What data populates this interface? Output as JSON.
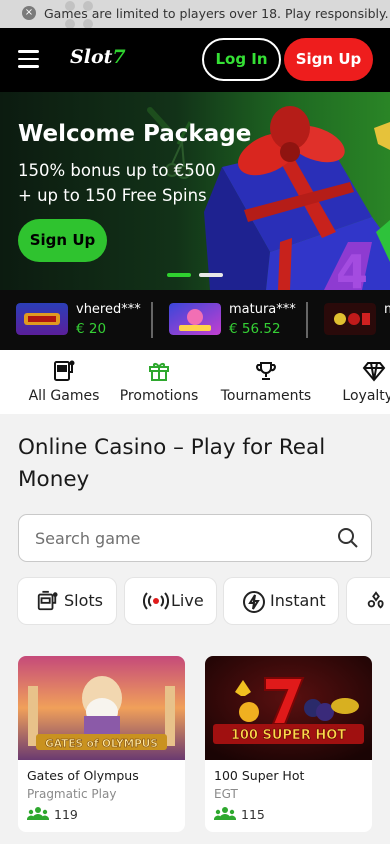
{
  "notice": {
    "text": "Games are limited to players over 18. Play responsibly.",
    "close_icon": "close-icon"
  },
  "header": {
    "logo": {
      "text": "Slot",
      "seven": "7"
    },
    "login_label": "Log In",
    "signup_label": "Sign Up"
  },
  "banner": {
    "title": "Welcome Package",
    "line1": "150% bonus up to €500",
    "line2": "+ up to 150 Free Spins",
    "cta_label": "Sign Up",
    "slides": 2,
    "active_slide": 1
  },
  "winners": [
    {
      "name": "vhered***",
      "amount": "€ 20"
    },
    {
      "name": "matura***",
      "amount": "€ 56.52"
    },
    {
      "name": "m",
      "amount": ""
    }
  ],
  "nav": [
    {
      "label": "All Games",
      "icon": "slot-machine-icon"
    },
    {
      "label": "Promotions",
      "icon": "gift-icon"
    },
    {
      "label": "Tournaments",
      "icon": "trophy-icon"
    },
    {
      "label": "Loyalty F",
      "icon": "diamond-icon"
    }
  ],
  "page_title": "Online Casino – Play for Real Money",
  "search": {
    "placeholder": "Search game"
  },
  "categories": [
    {
      "label": "Slots",
      "icon": "slot-machine-icon"
    },
    {
      "label": "Live",
      "icon": "live-icon"
    },
    {
      "label": "Instant",
      "icon": "lightning-icon"
    },
    {
      "label": "",
      "icon": "cards-icon"
    }
  ],
  "games": [
    {
      "art_text": "GATES of OLYMPUS",
      "name": "Gates of Olympus",
      "provider": "Pragmatic Play",
      "players": "119"
    },
    {
      "art_text": "100 SUPER HOT",
      "name": "100 Super Hot",
      "provider": "EGT",
      "players": "115"
    }
  ],
  "colors": {
    "accent_green": "#2fc32f",
    "signup_red": "#ee1d1d",
    "header_bg": "#000000"
  }
}
